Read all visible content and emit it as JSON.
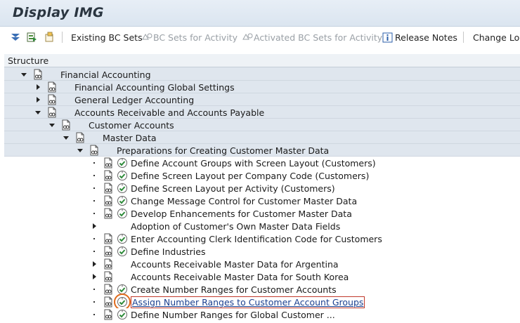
{
  "window": {
    "title": "Display IMG"
  },
  "toolbar": {
    "existing_bc_sets": "Existing BC Sets",
    "bc_sets_for_activity": "BC Sets for Activity",
    "activated_bc_sets": "Activated BC Sets for Activity",
    "release_notes": "Release Notes",
    "change_log": "Change Log"
  },
  "structure": {
    "header": "Structure",
    "nodes": [
      {
        "label": "Financial Accounting",
        "expander": "expanded",
        "has_activity": false
      },
      {
        "label": "Financial Accounting Global Settings",
        "expander": "collapsed",
        "has_activity": false
      },
      {
        "label": "General Ledger Accounting",
        "expander": "collapsed",
        "has_activity": false
      },
      {
        "label": "Accounts Receivable and Accounts Payable",
        "expander": "expanded",
        "has_activity": false
      },
      {
        "label": "Customer Accounts",
        "expander": "expanded",
        "has_activity": false
      },
      {
        "label": "Master Data",
        "expander": "expanded",
        "has_activity": false
      },
      {
        "label": "Preparations for Creating Customer Master Data",
        "expander": "expanded",
        "has_activity": false
      },
      {
        "label": "Define Account Groups with Screen Layout (Customers)",
        "expander": "leaf",
        "has_activity": true
      },
      {
        "label": "Define Screen Layout per Company Code (Customers)",
        "expander": "leaf",
        "has_activity": true
      },
      {
        "label": "Define Screen Layout per Activity (Customers)",
        "expander": "leaf",
        "has_activity": true
      },
      {
        "label": "Change Message Control for Customer Master Data",
        "expander": "leaf",
        "has_activity": true
      },
      {
        "label": "Develop Enhancements for Customer Master Data",
        "expander": "leaf",
        "has_activity": true
      },
      {
        "label": "Adoption of Customer's Own Master Data Fields",
        "expander": "collapsed",
        "has_activity": false,
        "no_doc": true
      },
      {
        "label": "Enter Accounting Clerk Identification Code for Customers",
        "expander": "leaf",
        "has_activity": true
      },
      {
        "label": "Define Industries",
        "expander": "leaf",
        "has_activity": true
      },
      {
        "label": "Accounts Receivable Master Data for Argentina",
        "expander": "collapsed",
        "has_activity": false
      },
      {
        "label": "Accounts Receivable Master Data for South Korea",
        "expander": "collapsed",
        "has_activity": false
      },
      {
        "label": "Create Number Ranges for Customer Accounts",
        "expander": "leaf",
        "has_activity": true
      },
      {
        "label": "Assign Number Ranges to Customer Account Groups",
        "expander": "leaf",
        "has_activity": true,
        "selected": true
      },
      {
        "label": "Define Number Ranges for Global Customer ...",
        "expander": "leaf",
        "has_activity": true
      }
    ]
  },
  "colors": {
    "accent_orange": "#e06a1a",
    "selection_border": "#c0392b",
    "activity_green": "#2e8b3a"
  }
}
